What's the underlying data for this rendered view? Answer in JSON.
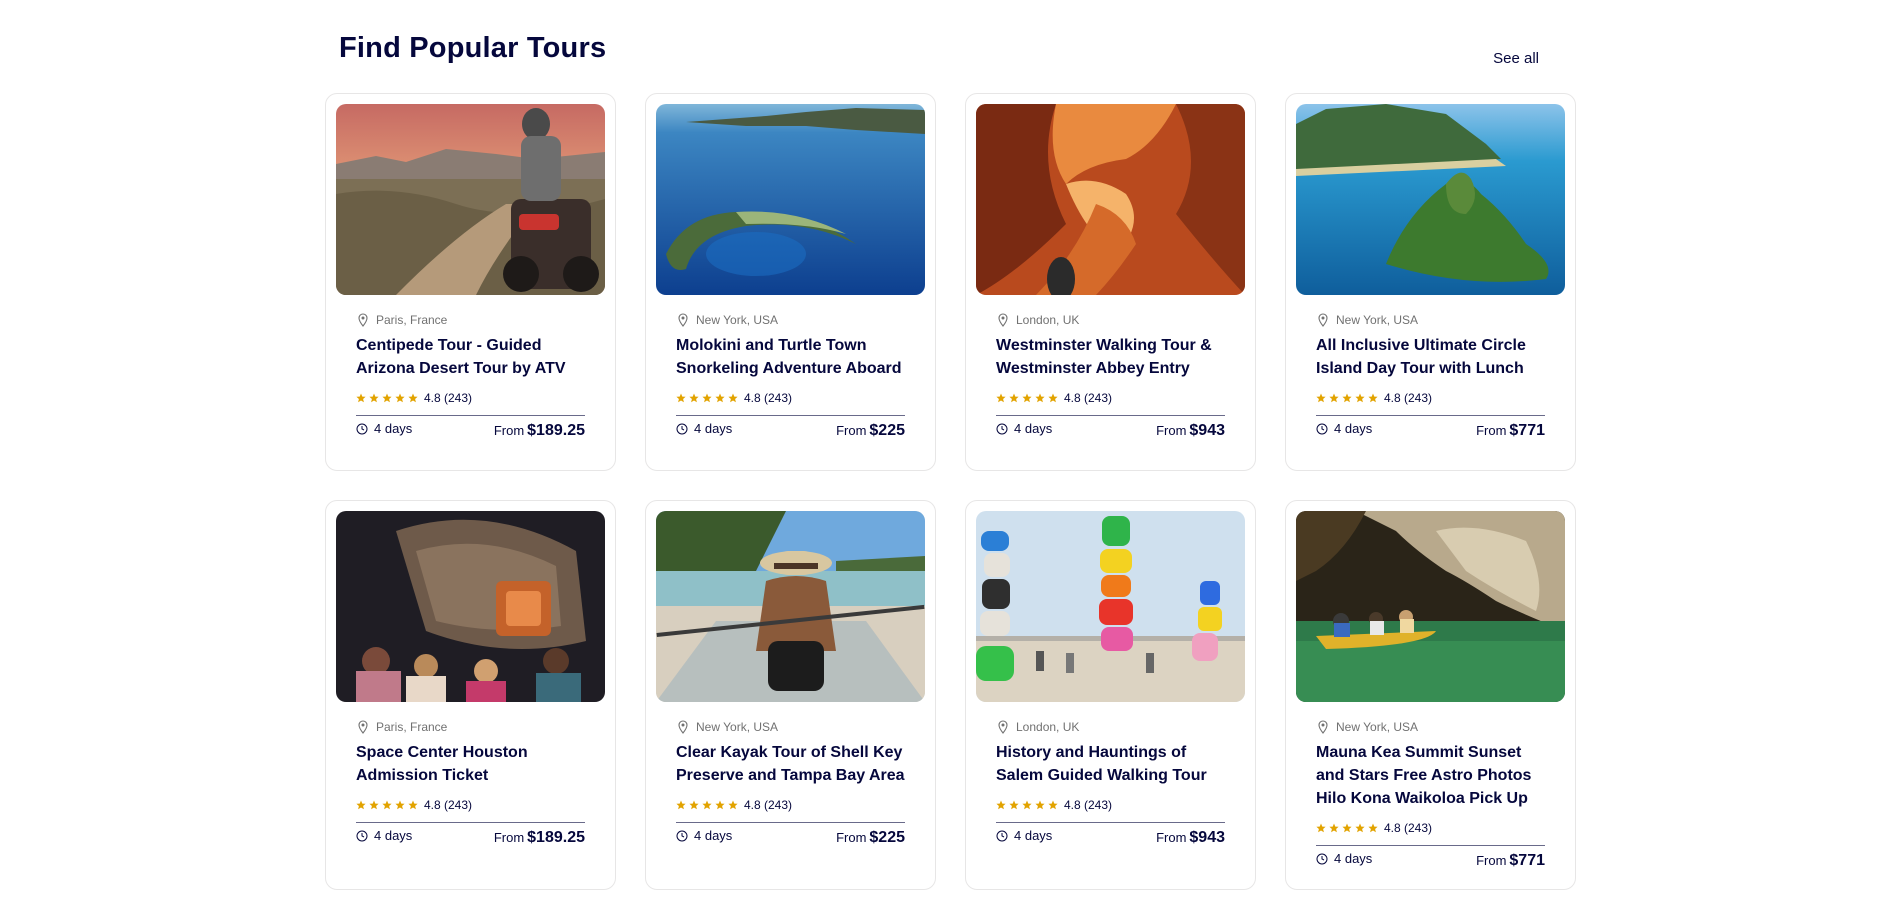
{
  "section": {
    "title": "Find Popular Tours",
    "see_all_label": "See all"
  },
  "colors": {
    "text": "#05073c",
    "muted": "#717171",
    "border": "#e7e6e6",
    "star": "#e2a300"
  },
  "icons": {
    "location": "pin-icon",
    "rating": "star-icon",
    "duration": "clock-icon"
  },
  "tours": [
    {
      "location": "Paris, France",
      "title": "Centipede Tour - Guided Arizona Desert Tour by ATV",
      "rating": "4.8 (243)",
      "duration": "4 days",
      "price_prefix": "From",
      "price": "$189.25",
      "image": "desert-atv-rider"
    },
    {
      "location": "New York, USA",
      "title": "Molokini and Turtle Town Snorkeling Adventure Aboard",
      "rating": "4.8 (243)",
      "duration": "4 days",
      "price_prefix": "From",
      "price": "$225",
      "image": "crescent-island-ocean"
    },
    {
      "location": "London, UK",
      "title": "Westminster Walking Tour & Westminster Abbey Entry",
      "rating": "4.8 (243)",
      "duration": "4 days",
      "price_prefix": "From",
      "price": "$943",
      "image": "slot-canyon"
    },
    {
      "location": "New York, USA",
      "title": "All Inclusive Ultimate Circle Island Day Tour with Lunch",
      "rating": "4.8 (243)",
      "duration": "4 days",
      "price_prefix": "From",
      "price": "$771",
      "image": "tropical-island-coast"
    },
    {
      "location": "Paris, France",
      "title": "Space Center Houston Admission Ticket",
      "rating": "4.8 (243)",
      "duration": "4 days",
      "price_prefix": "From",
      "price": "$189.25",
      "image": "space-capsule-exhibit"
    },
    {
      "location": "New York, USA",
      "title": "Clear Kayak Tour of Shell Key Preserve and Tampa Bay Area",
      "rating": "4.8 (243)",
      "duration": "4 days",
      "price_prefix": "From",
      "price": "$225",
      "image": "kayaker-hat"
    },
    {
      "location": "London, UK",
      "title": "History and Hauntings of Salem Guided Walking Tour",
      "rating": "4.8 (243)",
      "duration": "4 days",
      "price_prefix": "From",
      "price": "$943",
      "image": "colorful-rock-totems"
    },
    {
      "location": "New York, USA",
      "title": "Mauna Kea Summit Sunset and Stars Free Astro Photos Hilo Kona Waikoloa Pick Up",
      "rating": "4.8 (243)",
      "duration": "4 days",
      "price_prefix": "From",
      "price": "$771",
      "image": "sea-cave-kayak"
    }
  ]
}
